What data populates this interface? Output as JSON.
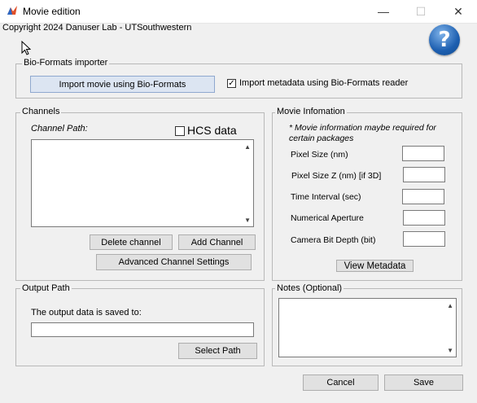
{
  "window": {
    "title": "Movie edition",
    "minimize_glyph": "—",
    "maximize_glyph": "☐",
    "close_glyph": "✕"
  },
  "copyright": "Copyright 2024 Danuser Lab - UTSouthwestern",
  "help_glyph": "?",
  "bioformats": {
    "legend": "Bio-Formats importer",
    "import_button": "Import movie using Bio-Formats",
    "metadata_checkbox_label": "Import metadata using Bio-Formats reader",
    "metadata_checked": true,
    "check_glyph": "✓"
  },
  "channels": {
    "legend": "Channels",
    "channel_path_label": "Channel Path:",
    "hcs_label": "HCS data",
    "hcs_checked": false,
    "delete_button": "Delete channel",
    "add_button": "Add Channel",
    "advanced_button": "Advanced Channel Settings"
  },
  "movie_info": {
    "legend": "Movie Infomation",
    "note": "* Movie information maybe required for certain packages",
    "fields": [
      {
        "label": "Pixel Size (nm)",
        "value": ""
      },
      {
        "label": "Pixel Size Z (nm) [if 3D]",
        "value": ""
      },
      {
        "label": "Time Interval (sec)",
        "value": ""
      },
      {
        "label": "Numerical Aperture",
        "value": ""
      },
      {
        "label": "Camera Bit Depth (bit)",
        "value": ""
      }
    ],
    "view_metadata_button": "View Metadata"
  },
  "output": {
    "legend": "Output Path",
    "label": "The output data is saved to:",
    "value": "",
    "select_button": "Select Path"
  },
  "notes": {
    "legend": "Notes (Optional)",
    "value": ""
  },
  "footer": {
    "cancel_button": "Cancel",
    "save_button": "Save"
  },
  "scroll_glyphs": {
    "up": "▲",
    "down": "▼"
  }
}
